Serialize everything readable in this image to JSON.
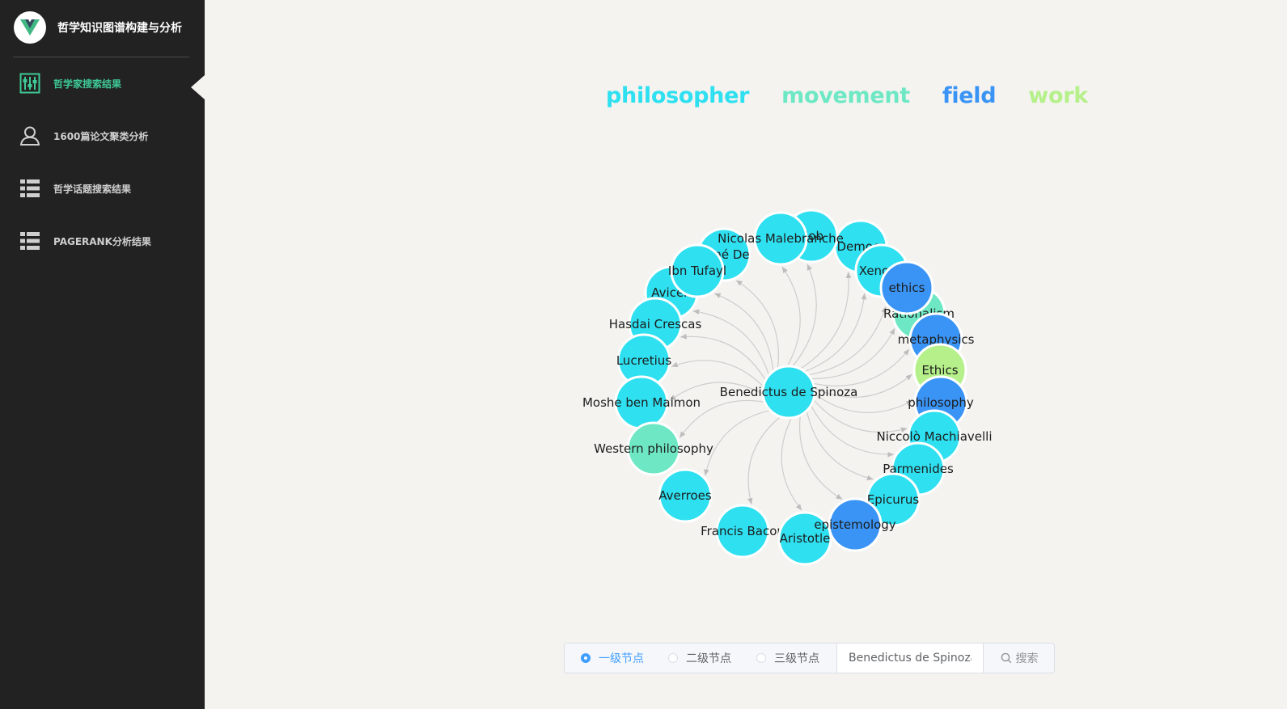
{
  "app": {
    "title": "哲学知识图谱构建与分析"
  },
  "sidebar": {
    "items": [
      {
        "label": "哲学家搜索结果",
        "icon": "sliders-icon",
        "active": true
      },
      {
        "label": "1600篇论文聚类分析",
        "icon": "user-icon",
        "active": false
      },
      {
        "label": "哲学话题搜索结果",
        "icon": "list-icon",
        "active": false
      },
      {
        "label": "PAGERANK分析结果",
        "icon": "list-icon",
        "active": false
      }
    ],
    "active_color": "#3ec996"
  },
  "legend": [
    {
      "label": "philosopher",
      "color": "#2ee0f0"
    },
    {
      "label": "movement",
      "color": "#6ee8c4"
    },
    {
      "label": "field",
      "color": "#3a94f5"
    },
    {
      "label": "work",
      "color": "#b5f08a"
    }
  ],
  "graph": {
    "center": {
      "label": "Benedictus de Spinoza",
      "type": "philosopher"
    },
    "nodes": [
      {
        "label": "Avicenna",
        "display": "Avicen",
        "type": "philosopher"
      },
      {
        "label": "René Descartes",
        "display": "René De",
        "type": "philosopher"
      },
      {
        "label": "Hobbes",
        "display": "Hob",
        "type": "philosopher"
      },
      {
        "label": "Democritus",
        "display": "Democr",
        "type": "philosopher"
      },
      {
        "label": "Nicolas Malebranche",
        "display": "Nicolas Malebranche",
        "type": "philosopher"
      },
      {
        "label": "Ibn Tufayl",
        "display": "Ibn Tufayl",
        "type": "philosopher"
      },
      {
        "label": "Xenophon",
        "display": "Xenoph",
        "type": "philosopher"
      },
      {
        "label": "Rationalism",
        "display": "Rationalism",
        "type": "movement"
      },
      {
        "label": "ethics",
        "display": "ethics",
        "type": "field"
      },
      {
        "label": "Hasdai Crescas",
        "display": "Hasdai Crescas",
        "type": "philosopher"
      },
      {
        "label": "metaphysics",
        "display": "metaphysics",
        "type": "field"
      },
      {
        "label": "Lucretius",
        "display": "Lucretius",
        "type": "philosopher"
      },
      {
        "label": "Ethics",
        "display": "Ethics",
        "type": "work"
      },
      {
        "label": "philosophy",
        "display": "philosophy",
        "type": "field"
      },
      {
        "label": "Moshe ben Maimon",
        "display": "Moshe ben Maimon",
        "type": "philosopher"
      },
      {
        "label": "Niccolò Machiavelli",
        "display": "Niccolò Machiavelli",
        "type": "philosopher"
      },
      {
        "label": "Western philosophy",
        "display": "Western philosophy",
        "type": "movement"
      },
      {
        "label": "Parmenides",
        "display": "Parmenides",
        "type": "philosopher"
      },
      {
        "label": "Averroes",
        "display": "Averroes",
        "type": "philosopher"
      },
      {
        "label": "Epicurus",
        "display": "Epicurus",
        "type": "philosopher"
      },
      {
        "label": "Francis Bacon",
        "display": "Francis Bacon",
        "type": "philosopher"
      },
      {
        "label": "Aristotle",
        "display": "Aristotle",
        "type": "philosopher"
      },
      {
        "label": "epistemology",
        "display": "epistemology",
        "type": "field"
      }
    ]
  },
  "search": {
    "radios": [
      {
        "label": "一级节点",
        "checked": true
      },
      {
        "label": "二级节点",
        "checked": false
      },
      {
        "label": "三级节点",
        "checked": false
      }
    ],
    "value": "Benedictus de Spinoza",
    "button_label": "搜索",
    "button_icon": "search-icon"
  }
}
